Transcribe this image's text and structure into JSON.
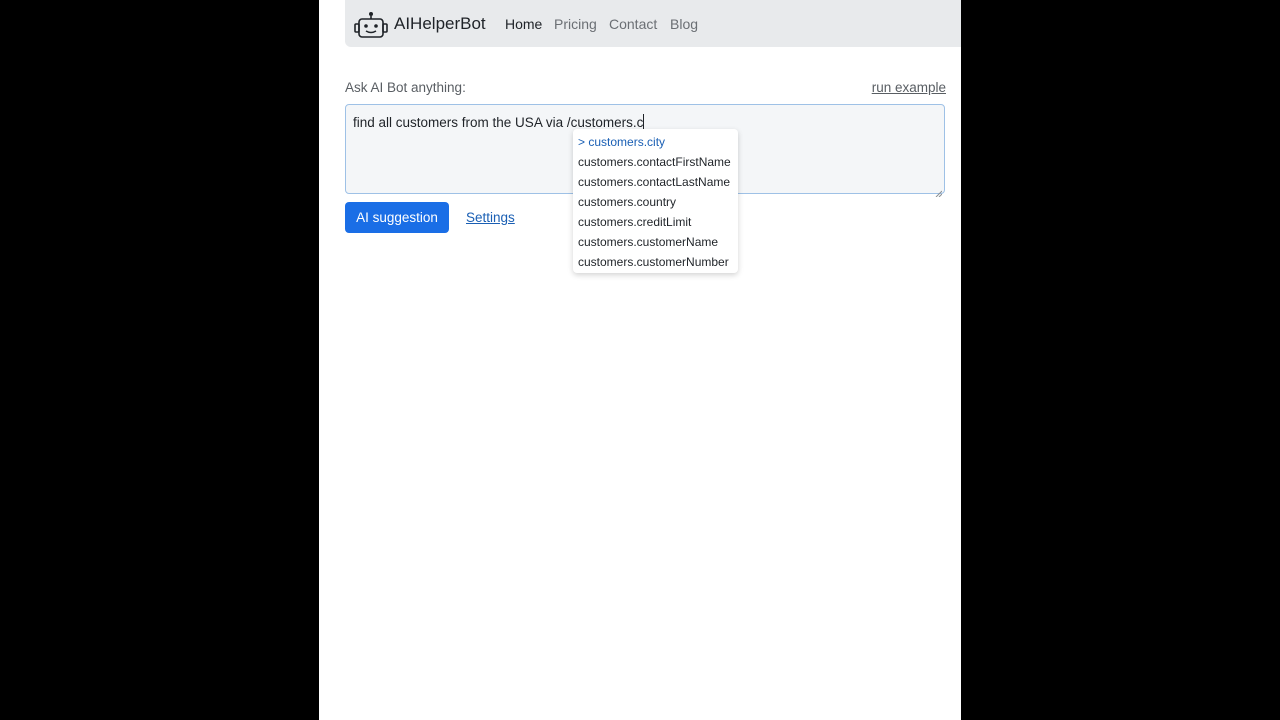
{
  "navbar": {
    "brand": "AIHelperBot",
    "links": [
      {
        "label": "Home",
        "active": true
      },
      {
        "label": "Pricing",
        "active": false
      },
      {
        "label": "Contact",
        "active": false
      },
      {
        "label": "Blog",
        "active": false
      }
    ]
  },
  "main": {
    "ask_label": "Ask AI Bot anything:",
    "run_example": "run example",
    "query_value": "find all customers from the USA via /customers.c",
    "ai_button": "AI suggestion",
    "settings_link": "Settings"
  },
  "autocomplete": {
    "items": [
      {
        "label": "> customers.city",
        "selected": true
      },
      {
        "label": "customers.contactFirstName",
        "selected": false
      },
      {
        "label": "customers.contactLastName",
        "selected": false
      },
      {
        "label": "customers.country",
        "selected": false
      },
      {
        "label": "customers.creditLimit",
        "selected": false
      },
      {
        "label": "customers.customerName",
        "selected": false
      },
      {
        "label": "customers.customerNumber",
        "selected": false
      }
    ]
  },
  "icons": {
    "brand": "robot-icon"
  },
  "colors": {
    "primary": "#1a6ee6",
    "link": "#1a5fb4",
    "navbar_bg": "#e8eaec",
    "textarea_border": "#9ec1e6"
  }
}
